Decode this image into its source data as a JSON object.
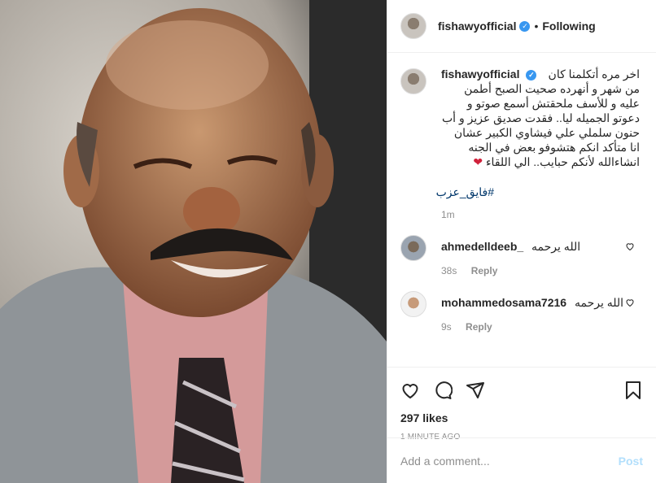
{
  "header": {
    "username": "fishawyofficial",
    "separator": "•",
    "follow_status": "Following"
  },
  "caption": {
    "username": "fishawyofficial",
    "text": "اخر مره أتكلمنا كان من شهر و أنهرده صحيت الصبح أطمن عليه و للأسف ملحقتش أسمع صوتو و دعوتو الجميله ليا.. فقدت صديق عزيز و أب حنون سلملي علي فيشاوي الكبير عشان انا متأكد انكم هتشوفو بعض في الجنه انشاءالله لأنكم حبايب.. الي اللقاء",
    "emoji": "❤",
    "hashtag": "#فايق_عزب",
    "time": "1m"
  },
  "comments": [
    {
      "username": "ahmedelldeeb_",
      "text": "الله يرحمه",
      "time": "38s",
      "reply": "Reply"
    },
    {
      "username": "mohammedosama7216",
      "text": "الله يرحمه",
      "time": "9s",
      "reply": "Reply"
    }
  ],
  "stats": {
    "likes": "297 likes",
    "posted": "1 MINUTE AGO"
  },
  "comment_box": {
    "placeholder": "Add a comment...",
    "post_label": "Post"
  },
  "colors": {
    "verified": "#3897f0",
    "link": "#00376b",
    "muted": "#8e8e8e",
    "post_disabled": "#b2dffc"
  }
}
